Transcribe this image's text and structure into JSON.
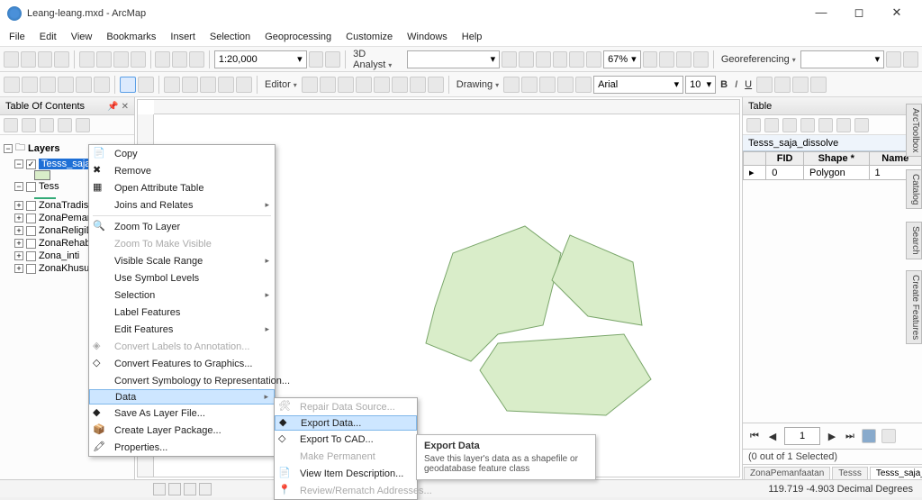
{
  "title": "Leang-leang.mxd - ArcMap",
  "menu": [
    "File",
    "Edit",
    "View",
    "Bookmarks",
    "Insert",
    "Selection",
    "Geoprocessing",
    "Customize",
    "Windows",
    "Help"
  ],
  "scale": "1:20,000",
  "zoom_pct": "67%",
  "analyst": "3D Analyst",
  "editor": "Editor",
  "drawing": "Drawing",
  "font": "Arial",
  "fontsize": "10",
  "georef": "Georeferencing",
  "toc": {
    "title": "Table Of Contents",
    "root": "Layers",
    "items": [
      {
        "label": "Tesss_saja_d",
        "checked": true,
        "sel": true,
        "swatch": "fill"
      },
      {
        "label": "Tess",
        "checked": false,
        "swatch": "line"
      },
      {
        "label": "ZonaTradisi",
        "checked": false
      },
      {
        "label": "ZonaPeman",
        "checked": false
      },
      {
        "label": "ZonaReligiD",
        "checked": false
      },
      {
        "label": "ZonaRehabi",
        "checked": false
      },
      {
        "label": "Zona_inti",
        "checked": false
      },
      {
        "label": "ZonaKhusus",
        "checked": false
      }
    ]
  },
  "ctx1": [
    {
      "t": "Copy",
      "ic": "copy-icon"
    },
    {
      "t": "Remove",
      "ic": "remove-icon"
    },
    {
      "t": "Open Attribute Table",
      "ic": "table-icon"
    },
    {
      "t": "Joins and Relates",
      "arrow": true
    },
    {
      "sep": true
    },
    {
      "t": "Zoom To Layer",
      "ic": "zoom-icon"
    },
    {
      "t": "Zoom To Make Visible",
      "dis": true
    },
    {
      "t": "Visible Scale Range",
      "arrow": true
    },
    {
      "t": "Use Symbol Levels"
    },
    {
      "t": "Selection",
      "arrow": true
    },
    {
      "t": "Label Features"
    },
    {
      "t": "Edit Features",
      "arrow": true
    },
    {
      "t": "Convert Labels to Annotation...",
      "dis": true,
      "ic": "conv-icon"
    },
    {
      "t": "Convert Features to Graphics...",
      "ic": "conv2-icon"
    },
    {
      "t": "Convert Symbology to Representation..."
    },
    {
      "t": "Data",
      "arrow": true,
      "hl": true
    },
    {
      "t": "Save As Layer File...",
      "ic": "save-icon"
    },
    {
      "t": "Create Layer Package...",
      "ic": "pkg-icon"
    },
    {
      "t": "Properties...",
      "ic": "prop-icon"
    }
  ],
  "ctx2": [
    {
      "t": "Repair Data Source...",
      "dis": true,
      "ic": "repair-icon"
    },
    {
      "t": "Export Data...",
      "hl": true,
      "ic": "export-icon"
    },
    {
      "t": "Export To CAD...",
      "ic": "cad-icon"
    },
    {
      "t": "Make Permanent",
      "dis": true
    },
    {
      "t": "View Item Description...",
      "ic": "desc-icon"
    },
    {
      "t": "Review/Rematch Addresses...",
      "dis": true,
      "ic": "addr-icon"
    }
  ],
  "tooltip": {
    "title": "Export Data",
    "desc": "Save this layer's data as a shapefile or geodatabase feature class"
  },
  "table": {
    "title": "Table",
    "layer": "Tesss_saja_dissolve",
    "cols": [
      "FID",
      "Shape *",
      "Name"
    ],
    "row": [
      "0",
      "Polygon",
      "1"
    ],
    "page": "1",
    "status": "(0 out of 1 Selected)",
    "tabs": [
      "ZonaPemanfaatan",
      "Tesss",
      "Tesss_saja_dissolve"
    ],
    "active": 2
  },
  "sidetabs": [
    "ArcToolbox",
    "Catalog",
    "Search",
    "Create Features"
  ],
  "footer": {
    "coords": "119.719  -4.903 Decimal Degrees"
  }
}
